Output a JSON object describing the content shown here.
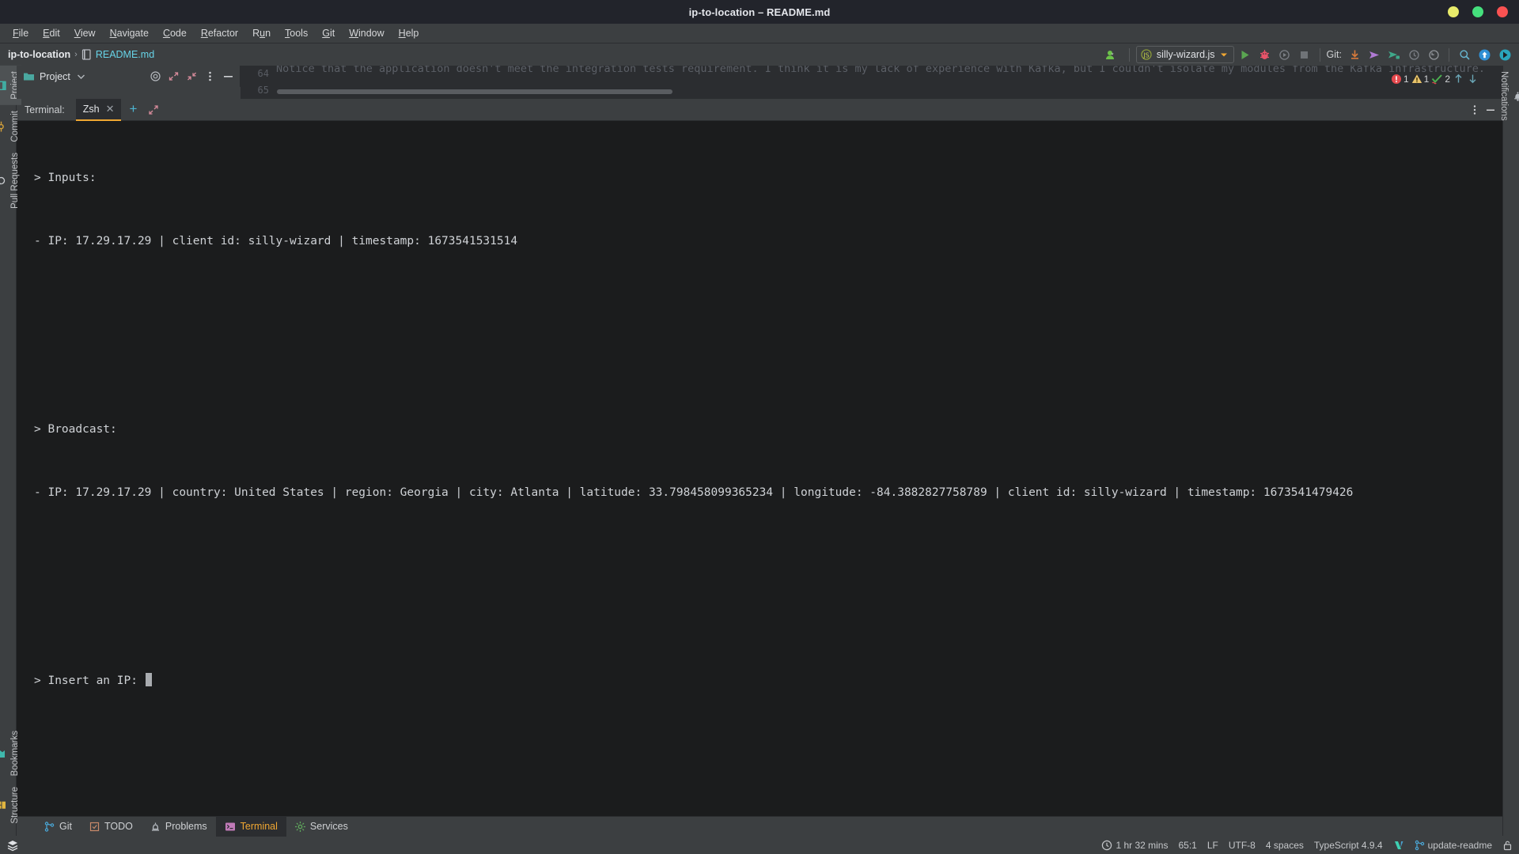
{
  "window": {
    "title": "ip-to-location – README.md",
    "controls": [
      {
        "name": "minimize",
        "color": "#e9ec6b"
      },
      {
        "name": "maximize",
        "color": "#45e07d"
      },
      {
        "name": "close",
        "color": "#fa5252"
      }
    ]
  },
  "menubar": {
    "items": [
      {
        "mnemonic": "F",
        "rest": "ile"
      },
      {
        "mnemonic": "E",
        "rest": "dit"
      },
      {
        "mnemonic": "V",
        "rest": "iew"
      },
      {
        "mnemonic": "N",
        "rest": "avigate"
      },
      {
        "mnemonic": "C",
        "rest": "ode"
      },
      {
        "mnemonic": "R",
        "rest": "efactor"
      },
      {
        "pre": "R",
        "mnemonic": "u",
        "rest": "n"
      },
      {
        "mnemonic": "T",
        "rest": "ools"
      },
      {
        "mnemonic": "G",
        "rest": "it"
      },
      {
        "mnemonic": "W",
        "rest": "indow"
      },
      {
        "mnemonic": "H",
        "rest": "elp"
      }
    ]
  },
  "navbar": {
    "breadcrumb": {
      "project": "ip-to-location",
      "separator": "›",
      "file": "README.md"
    },
    "run_config": {
      "label": "silly-wizard.js",
      "icon": "javascript-file-icon",
      "dropdown": "chevron-down-icon"
    },
    "git_label": "Git:",
    "buttons": [
      {
        "name": "run-button",
        "icon": "play-icon"
      },
      {
        "name": "debug-button",
        "icon": "bug-icon"
      },
      {
        "name": "run-with-coverage-button",
        "icon": "coverage-icon"
      },
      {
        "name": "stop-button",
        "icon": "stop-square-icon"
      },
      {
        "name": "git-update-project-button",
        "icon": "download-arrow-icon"
      },
      {
        "name": "git-commit-button",
        "icon": "commit-arrow-icon"
      },
      {
        "name": "git-push-button",
        "icon": "push-arrow-icon"
      },
      {
        "name": "git-history-button",
        "icon": "history-clock-icon"
      },
      {
        "name": "git-rollback-button",
        "icon": "rollback-icon"
      },
      {
        "name": "search-everywhere-button",
        "icon": "search-icon"
      },
      {
        "name": "updates-button",
        "icon": "update-arrow-up-icon"
      },
      {
        "name": "ai-assistant-button",
        "icon": "assistant-icon"
      }
    ],
    "account_icon": "user-account-icon"
  },
  "project_panel": {
    "title": "Project",
    "dropdown_icon": "chevron-down-icon",
    "icons": [
      {
        "name": "locate-file-icon"
      },
      {
        "name": "expand-all-icon"
      },
      {
        "name": "collapse-all-icon"
      },
      {
        "name": "options-menu-icon"
      },
      {
        "name": "hide-panel-icon"
      }
    ]
  },
  "editor_ghost": {
    "text": "Notice that the application doesn't meet the integration tests requirement. I think it is my lack of experience with Kafka, but I couldn't isolate my modules from the Kafka infrastructure.",
    "gutter_lines": [
      "64",
      "65"
    ],
    "inspections": {
      "errors": "1",
      "warnings": "1",
      "typos": "2",
      "nav_up_icon": "arrow-up-icon",
      "nav_down_icon": "arrow-down-icon"
    }
  },
  "left_rail": {
    "top": [
      {
        "label": "Project",
        "icon": "project-window-icon",
        "active": true
      },
      {
        "label": "Commit",
        "icon": "commit-icon",
        "active": false
      },
      {
        "label": "Pull Requests",
        "icon": "pull-request-icon",
        "active": false
      }
    ],
    "bottom": [
      {
        "label": "Bookmarks",
        "icon": "bookmarks-icon",
        "active": false
      },
      {
        "label": "Structure",
        "icon": "structure-icon",
        "active": false
      }
    ]
  },
  "right_rail": {
    "items": [
      {
        "label": "Notifications",
        "icon": "bell-icon",
        "active": false
      }
    ]
  },
  "terminal": {
    "label": "Terminal:",
    "tab": {
      "name": "Zsh",
      "close_icon": "close-icon"
    },
    "add_icon": "plus-icon",
    "expand_icon": "expand-diagonal-icon",
    "options_icon": "options-menu-icon",
    "minimize_icon": "minimize-icon",
    "lines": [
      "> Inputs:",
      "- IP: 17.29.17.29 | client id: silly-wizard | timestamp: 1673541531514",
      "",
      "",
      "> Broadcast:",
      "- IP: 17.29.17.29 | country: United States | region: Georgia | city: Atlanta | latitude: 33.798458099365234 | longitude: -84.3882827758789 | client id: silly-wizard | timestamp: 1673541479426",
      "",
      "",
      ""
    ],
    "prompt": "> Insert an IP: ",
    "cursor": "block-cursor"
  },
  "bottom_toolwindows": [
    {
      "label": "Git",
      "icon": "git-branch-icon",
      "active": false
    },
    {
      "label": "TODO",
      "icon": "todo-icon",
      "active": false
    },
    {
      "label": "Problems",
      "icon": "problems-icon",
      "active": false
    },
    {
      "label": "Terminal",
      "icon": "terminal-icon",
      "active": true
    },
    {
      "label": "Services",
      "icon": "services-gear-icon",
      "active": false
    }
  ],
  "statusbar": {
    "left_icon": "layers-icon",
    "items": [
      {
        "name": "time-tracking",
        "label": "1 hr 32 mins",
        "icon": "clock-icon"
      },
      {
        "name": "caret-position",
        "label": "65:1"
      },
      {
        "name": "line-separator",
        "label": "LF"
      },
      {
        "name": "file-encoding",
        "label": "UTF-8"
      },
      {
        "name": "indent",
        "label": "4 spaces"
      },
      {
        "name": "language-version",
        "label": "TypeScript 4.9.4"
      }
    ],
    "vcs_branch": "update-readme",
    "branch_icon": "git-branch-icon",
    "validation_icon": "validation-check-icon",
    "lock_icon": "read-only-lock-icon"
  },
  "colors": {
    "accent_orange": "#f0a732",
    "link_cyan": "#67d4e8",
    "terminal_bg": "#1b1c1d",
    "panel_bg": "#3c3f41",
    "editor_bg": "#2b2d30"
  }
}
